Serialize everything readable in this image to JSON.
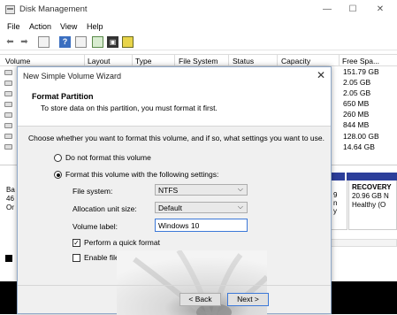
{
  "app": {
    "title": "Disk Management",
    "window_controls": {
      "minimize": "—",
      "maximize": "☐",
      "close": "✕"
    },
    "menu": [
      "File",
      "Action",
      "View",
      "Help"
    ]
  },
  "toolbar_icons": [
    "back-arrow-icon",
    "forward-arrow-icon",
    "console-tree-icon",
    "help-icon",
    "properties-icon",
    "refresh-icon",
    "rescan-icon"
  ],
  "volume_table": {
    "headers": [
      "Volume",
      "Layout",
      "Type",
      "File System",
      "Status",
      "Capacity",
      "Free Spa..."
    ],
    "free_space": [
      "151.79 GB",
      "2.05 GB",
      "2.05 GB",
      "650 MB",
      "260 MB",
      "844 MB",
      "128.00 GB",
      "14.64 GB"
    ]
  },
  "disk_pane": {
    "disk_label_fragments": [
      "Ba",
      "46",
      "Or"
    ],
    "small_partition_text": [
      "9",
      "n",
      "y"
    ],
    "recovery": {
      "name": "RECOVERY",
      "size": "20.96 GB N",
      "status": "Healthy (O"
    }
  },
  "wizard": {
    "title": "New Simple Volume Wizard",
    "close": "✕",
    "header_title": "Format Partition",
    "header_subtitle": "To store data on this partition, you must format it first.",
    "intro": "Choose whether you want to format this volume, and if so, what settings you want to use.",
    "option_no_format": "Do not format this volume",
    "option_format": "Format this volume with the following settings:",
    "file_system_label": "File system:",
    "file_system_value": "NTFS",
    "allocation_label": "Allocation unit size:",
    "allocation_value": "Default",
    "volume_label_label": "Volume label:",
    "volume_label_value": "Windows 10",
    "quick_format_label": "Perform a quick format",
    "quick_format_checked": true,
    "compression_label": "Enable file",
    "back_button": "< Back",
    "next_button": "Next >"
  }
}
